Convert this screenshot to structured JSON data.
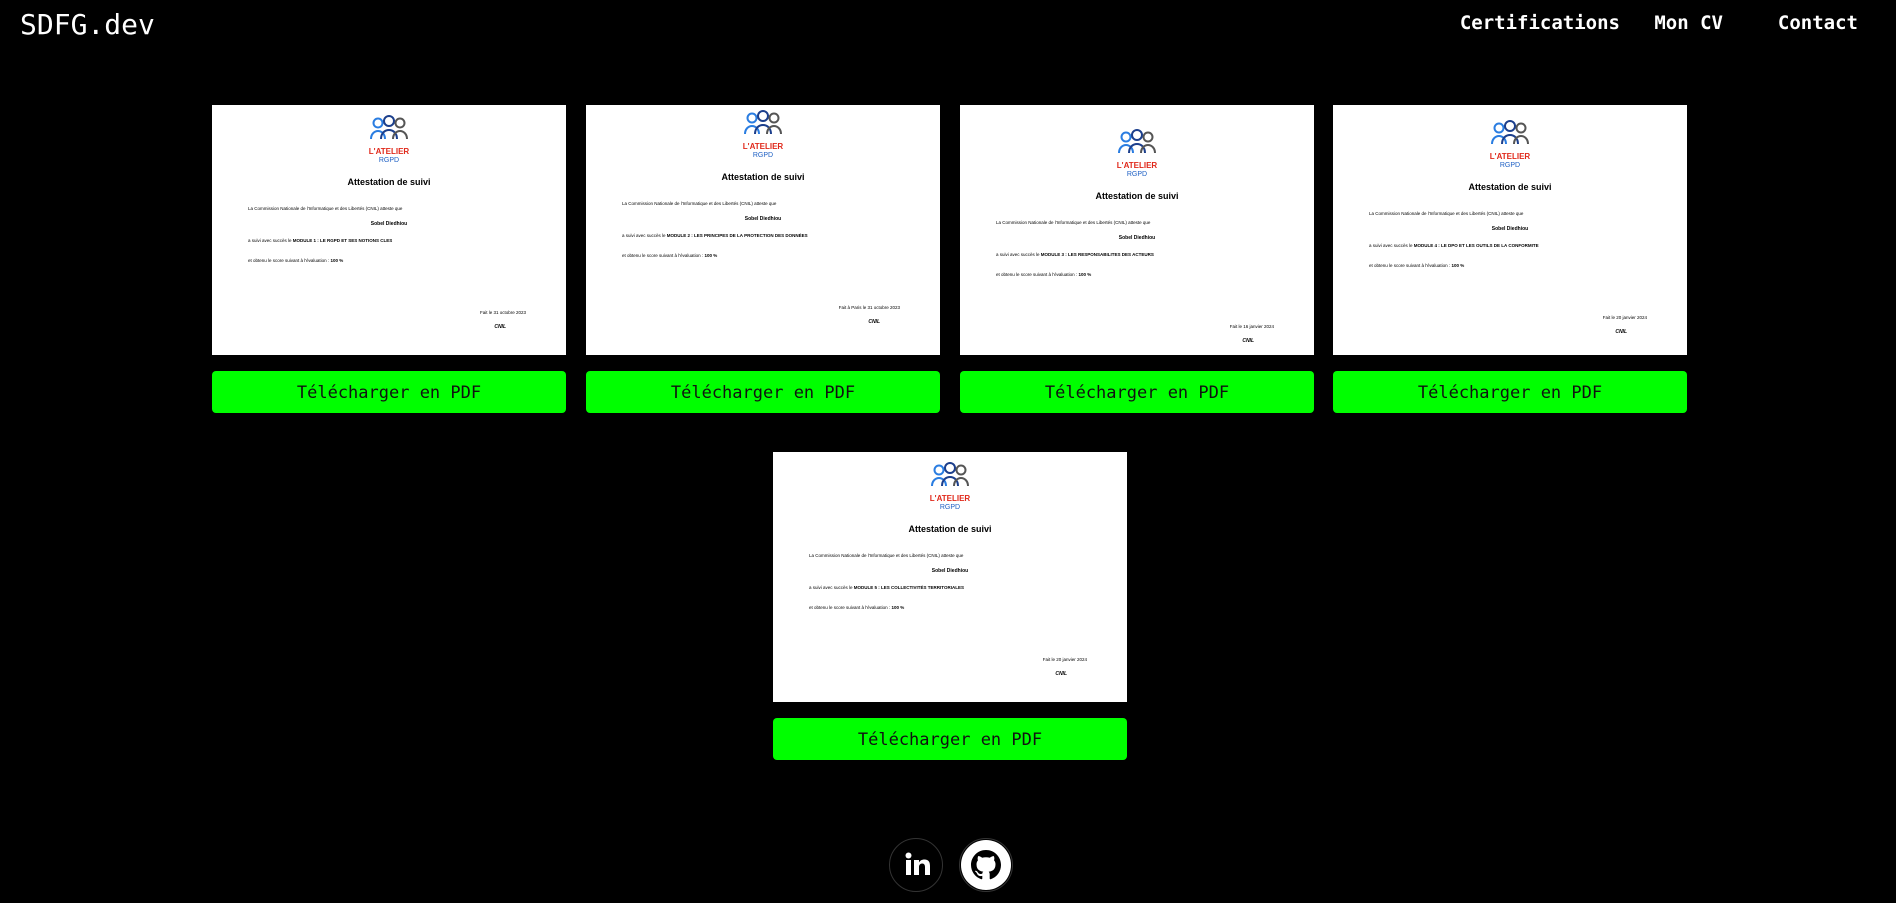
{
  "header": {
    "logo": "SDFG.dev",
    "nav": [
      {
        "label": "Certifications"
      },
      {
        "label": "Mon CV"
      },
      {
        "label": "Contact"
      }
    ]
  },
  "certificates": [
    {
      "org_line1": "L'ATELIER",
      "org_line2": "RGPD",
      "title": "Attestation de suivi",
      "intro": "La Commission Nationale de l'Informatique et des Libertés (CNIL) atteste que",
      "name": "Sobel Diedhiou",
      "module_prefix": "a suivi avec succès le",
      "module": "MODULE 1 : LE RGPD ET SES NOTIONS CLES",
      "score_prefix": "et obtenu le score suivant à l'évaluation :",
      "score": "100 %",
      "place_date": "Fait le  31 octobre 2023",
      "signer": "CNIL",
      "button": "Télécharger en PDF"
    },
    {
      "org_line1": "L'ATELIER",
      "org_line2": "RGPD",
      "title": "Attestation de suivi",
      "intro": "La Commission Nationale de l'Informatique et des Libertés (CNIL) atteste que",
      "name": "Sobel Diedhiou",
      "module_prefix": "a suivi avec succès le",
      "module": "MODULE 2 : LES PRINCIPES DE LA PROTECTION DES DONNÉES",
      "score_prefix": "et obtenu le score suivant à l'évaluation :",
      "score": "100 %",
      "place_date": "Fait à Paris le  31 octobre 2023",
      "signer": "CNIL",
      "button": "Télécharger en PDF"
    },
    {
      "org_line1": "L'ATELIER",
      "org_line2": "RGPD",
      "title": "Attestation de suivi",
      "intro": "La Commission Nationale de l'Informatique et des Libertés (CNIL) atteste que",
      "name": "Sobel Diedhiou",
      "module_prefix": "a suivi avec succès le",
      "module": "MODULE 3 : LES RESPONSABILITES DES ACTEURS",
      "score_prefix": "et obtenu le score suivant à l'évaluation :",
      "score": "100 %",
      "place_date": "Fait le  16 janvier 2024",
      "signer": "CNIL",
      "button": "Télécharger en PDF"
    },
    {
      "org_line1": "L'ATELIER",
      "org_line2": "RGPD",
      "title": "Attestation de suivi",
      "intro": "La Commission Nationale de l'Informatique et des Libertés (CNIL) atteste que",
      "name": "Sobel Diedhiou",
      "module_prefix": "a suivi avec succès le",
      "module": "MODULE 4 : LE DPO ET LES OUTILS DE LA CONFORMITE",
      "score_prefix": "et obtenu le score suivant à l'évaluation :",
      "score": "100 %",
      "place_date": "Fait le  20 janvier 2024",
      "signer": "CNIL",
      "button": "Télécharger en PDF"
    },
    {
      "org_line1": "L'ATELIER",
      "org_line2": "RGPD",
      "title": "Attestation de suivi",
      "intro": "La Commission Nationale de l'Informatique et des Libertés (CNIL) atteste que",
      "name": "Sobel Diedhiou",
      "module_prefix": "a suivi avec succès le",
      "module": "MODULE 5 : LES COLLECTIVITÉS TERRITORIALES",
      "score_prefix": "et obtenu le score suivant à l'évaluation :",
      "score": "100 %",
      "place_date": "Fait le  20 janvier 2024",
      "signer": "CNIL",
      "button": "Télécharger en PDF"
    }
  ],
  "footer": {
    "social": [
      {
        "icon": "linkedin-icon"
      },
      {
        "icon": "github-icon"
      }
    ]
  },
  "colors": {
    "background": "#000000",
    "button": "#00ff00",
    "text": "#ffffff"
  }
}
